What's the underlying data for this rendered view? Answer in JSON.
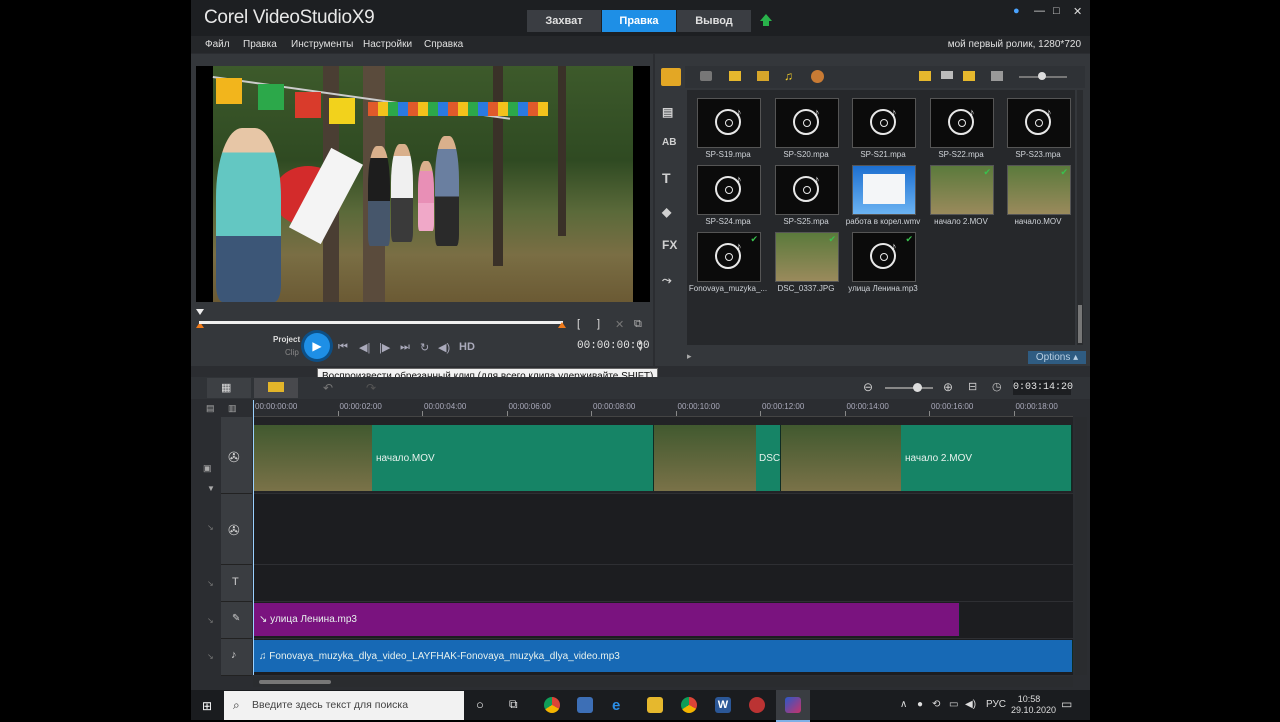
{
  "app": {
    "logo": "Corel VideoStudio",
    "version": "X9",
    "tabs": [
      "Захват",
      "Правка",
      "Вывод"
    ],
    "active_tab": "Правка",
    "project_info": "мой первый ролик, 1280*720"
  },
  "menu": [
    "Файл",
    "Правка",
    "Инструменты",
    "Настройки",
    "Справка"
  ],
  "player": {
    "mode_project": "Project",
    "mode_clip": "Clip",
    "hd_label": "HD",
    "timecode": "00:00:00:00",
    "tooltip": "Воспроизвести обрезанный клип (для всего клипа удерживайте SHIFT)",
    "trim_in": "[",
    "trim_out": "]"
  },
  "library": {
    "items": [
      {
        "name": "SP-S19.mpa",
        "type": "audio"
      },
      {
        "name": "SP-S20.mpa",
        "type": "audio"
      },
      {
        "name": "SP-S21.mpa",
        "type": "audio"
      },
      {
        "name": "SP-S22.mpa",
        "type": "audio"
      },
      {
        "name": "SP-S23.mpa",
        "type": "audio"
      },
      {
        "name": "SP-S24.mpa",
        "type": "audio"
      },
      {
        "name": "SP-S25.mpa",
        "type": "audio"
      },
      {
        "name": "работа в корел.wmv",
        "type": "screen"
      },
      {
        "name": "начало 2.MOV",
        "type": "photo"
      },
      {
        "name": "начало.MOV",
        "type": "photo"
      },
      {
        "name": "Fonovaya_muzyka_...",
        "type": "audio"
      },
      {
        "name": "DSC_0337.JPG",
        "type": "photo"
      },
      {
        "name": "улица Ленина.mp3",
        "type": "audio"
      }
    ],
    "options_label": "Options",
    "side_labels": [
      "AB",
      "T",
      "FX"
    ]
  },
  "timeline": {
    "timecode": "0:03:14:20",
    "ruler": [
      "00:00:00:00",
      "00:00:02:00",
      "00:00:04:00",
      "00:00:06:00",
      "00:00:08:00",
      "00:00:10:00",
      "00:00:12:00",
      "00:00:14:00",
      "00:00:16:00",
      "00:00:18:00"
    ],
    "video_clips": [
      "начало.MOV",
      "DSC",
      "начало 2.MOV"
    ],
    "voice_clip": "улица Ленина.mp3",
    "music_clip": "Fonovaya_muzyka_dlya_video_LAYFHAK-Fonovaya_muzyka_dlya_video.mp3"
  },
  "taskbar": {
    "search_placeholder": "Введите здесь текст для поиска",
    "lang": "РУС",
    "time": "10:58",
    "date": "29.10.2020"
  }
}
